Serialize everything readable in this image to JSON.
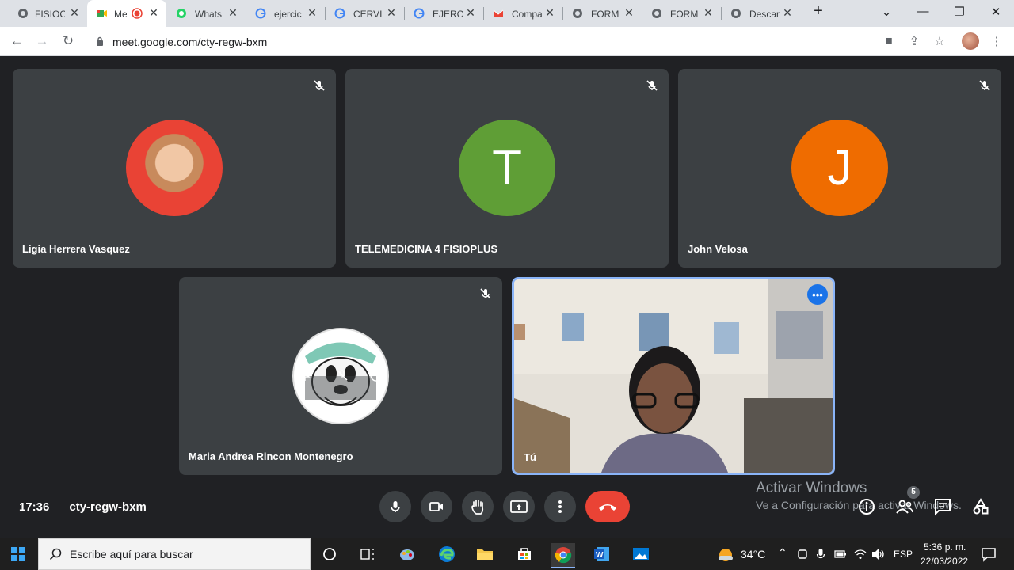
{
  "browser": {
    "tabs": [
      {
        "label": "FISIOC",
        "icon": "globe-icon"
      },
      {
        "label": "Me",
        "icon": "google-meet-icon",
        "active": true
      },
      {
        "label": "Whats",
        "icon": "whatsapp-icon"
      },
      {
        "label": "ejercic",
        "icon": "google-icon"
      },
      {
        "label": "CERVIC",
        "icon": "google-icon"
      },
      {
        "label": "EJERCI",
        "icon": "google-icon"
      },
      {
        "label": "Compa",
        "icon": "gmail-icon"
      },
      {
        "label": "FORM",
        "icon": "globe-icon"
      },
      {
        "label": "FORM",
        "icon": "globe-icon"
      },
      {
        "label": "Descar",
        "icon": "globe-icon"
      }
    ],
    "url": "meet.google.com/cty-regw-bxm"
  },
  "participants": [
    {
      "name": "Ligia Herrera Vasquez",
      "avatar": "photo",
      "muted": true
    },
    {
      "name": "TELEMEDICINA 4 FISIOPLUS",
      "initial": "T",
      "color": "#5f9e36",
      "muted": true
    },
    {
      "name": "John Velosa",
      "initial": "J",
      "color": "#ef6c00",
      "muted": true
    },
    {
      "name": "Maria Andrea Rincon Montenegro",
      "avatar": "mickey",
      "muted": true
    },
    {
      "name": "Tú",
      "avatar": "camera",
      "muted": false
    }
  ],
  "meeting": {
    "time": "17:36",
    "code": "cty-regw-bxm",
    "participant_count": "5"
  },
  "watermark": {
    "line1": "Activar Windows",
    "line2": "Ve a Configuración para activar Windows."
  },
  "taskbar": {
    "search_placeholder": "Escribe aquí para buscar",
    "temperature": "34°C",
    "language": "ESP",
    "clock_time": "5:36 p. m.",
    "clock_date": "22/03/2022"
  },
  "colors": {
    "accent": "#8ab4f8",
    "end_call": "#ea4335",
    "tile_bg": "#3c4043",
    "page_bg": "#202124"
  }
}
